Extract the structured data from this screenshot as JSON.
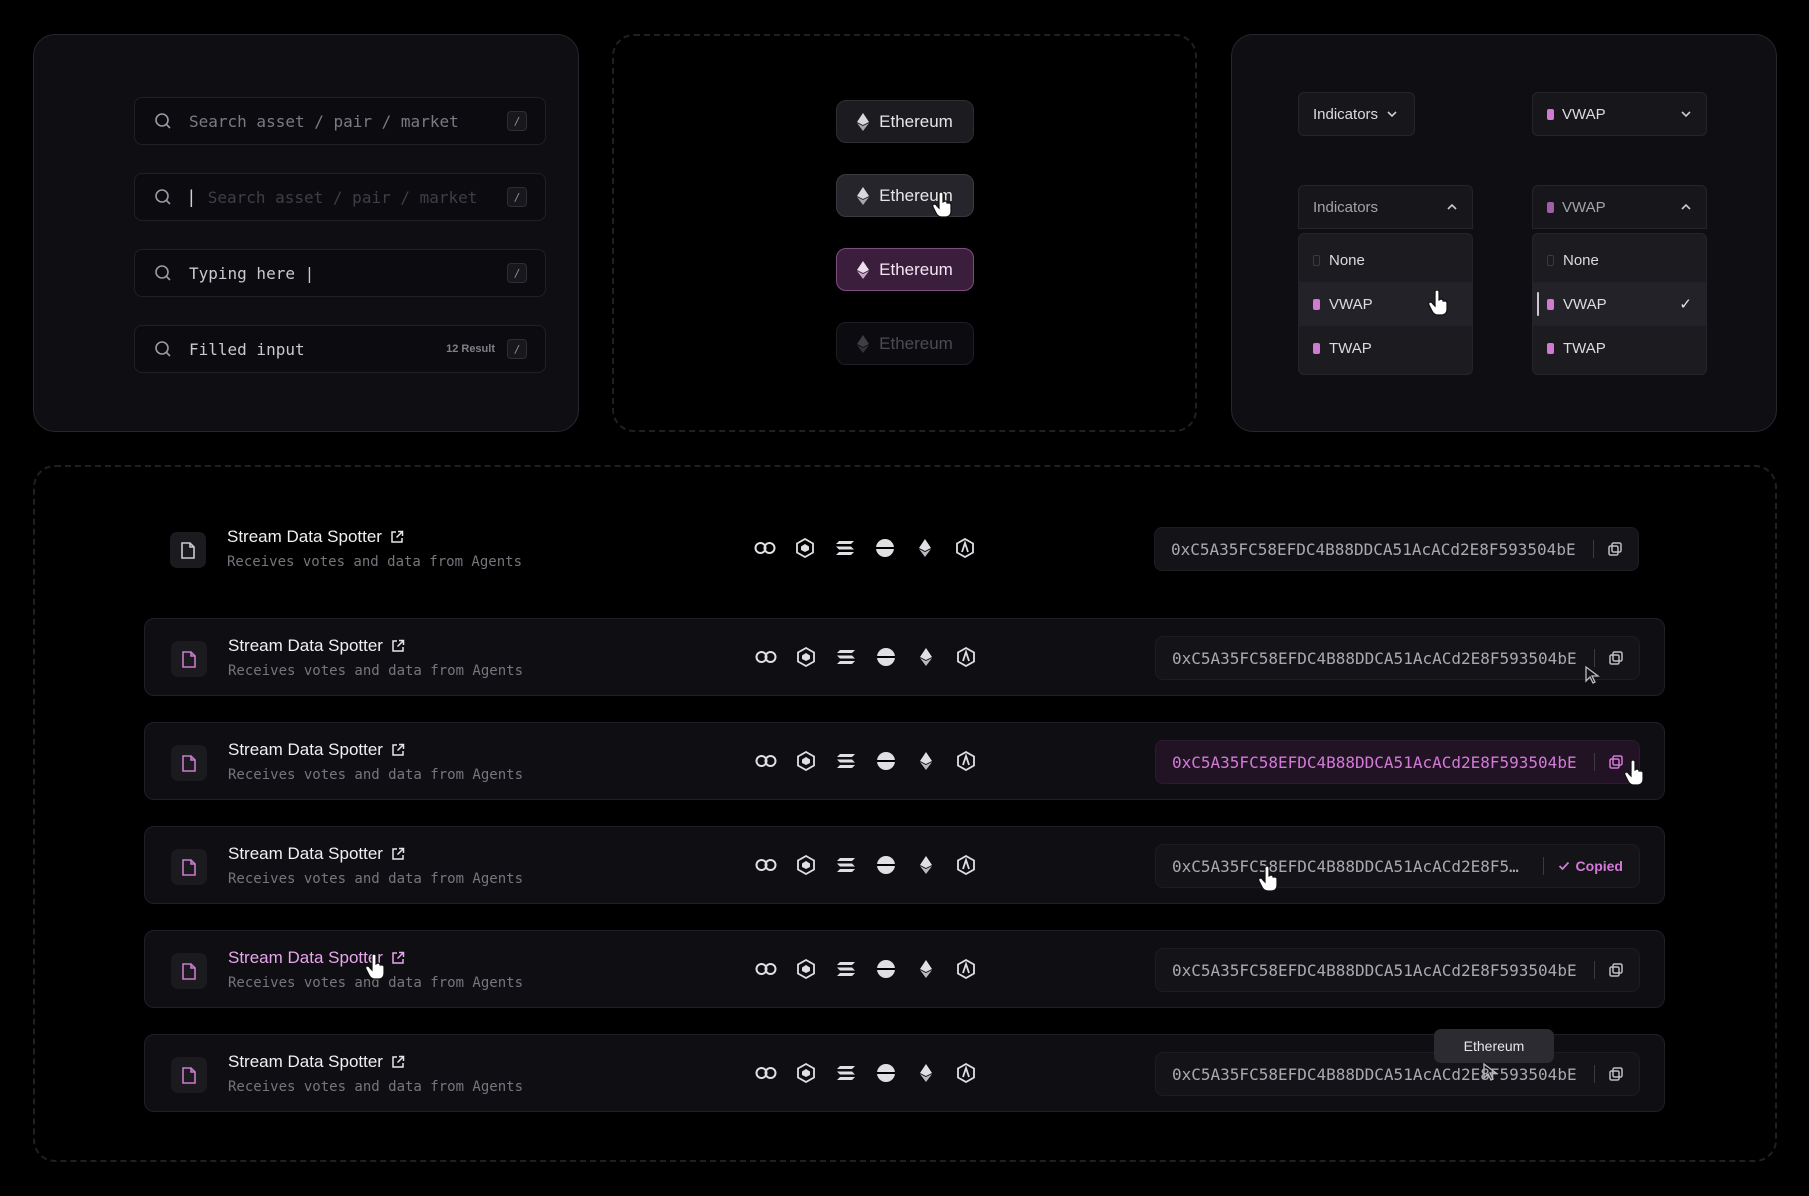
{
  "search_panel": {
    "inputs": [
      {
        "placeholder": "Search asset / pair / market",
        "key": "/"
      },
      {
        "placeholder": "Search asset / pair / market",
        "key": "/"
      },
      {
        "value": "Typing here  |",
        "key": "/"
      },
      {
        "value": "Filled input",
        "count": "12 Result",
        "key": "/"
      }
    ],
    "caret": "|"
  },
  "chips": {
    "label": "Ethereum",
    "states": [
      "default",
      "hover",
      "active",
      "disabled"
    ]
  },
  "dropdowns": {
    "indicators_label": "Indicators",
    "vwap_label": "VWAP",
    "options": [
      "None",
      "VWAP",
      "TWAP"
    ],
    "check": "✓"
  },
  "rows": {
    "title": "Stream Data Spotter",
    "description": "Receives votes and data from Agents",
    "address": "0xC5A35FC58EFDC4B88DDCA51AcACd2E8F593504bE",
    "address_truncated": "0xC5A35FC58EFDC4B88DDCA51AcACd2E8F5…",
    "copied_label": "Copied",
    "icons": [
      "chainlink-icon",
      "binance-icon",
      "solana-icon",
      "circle-half-icon",
      "ethereum-icon",
      "arbitrum-icon"
    ]
  },
  "tooltip": "Ethereum",
  "colors": {
    "accent": "#d37ad8",
    "background": "#000000",
    "panel": "#0f0f13"
  }
}
